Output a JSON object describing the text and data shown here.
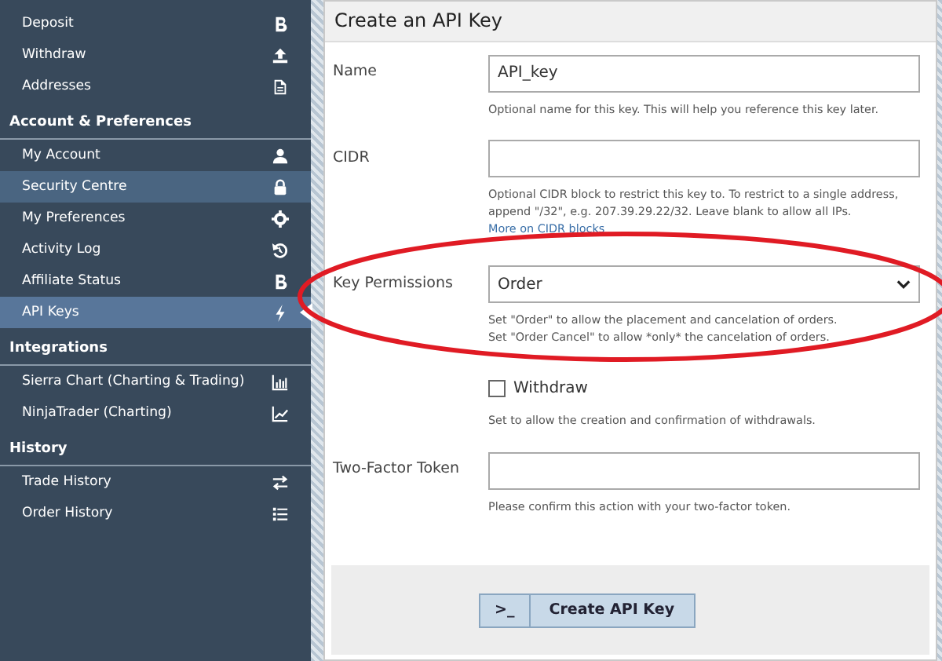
{
  "sidebar": {
    "sections": [
      {
        "items": [
          {
            "label": "Deposit",
            "selected": false,
            "highlighted": false
          },
          {
            "label": "Withdraw",
            "selected": false,
            "highlighted": false
          },
          {
            "label": "Addresses",
            "selected": false,
            "highlighted": false
          }
        ]
      },
      {
        "title": "Account & Preferences",
        "items": [
          {
            "label": "My Account",
            "selected": false,
            "highlighted": false
          },
          {
            "label": "Security Centre",
            "selected": false,
            "highlighted": true
          },
          {
            "label": "My Preferences",
            "selected": false,
            "highlighted": false
          },
          {
            "label": "Activity Log",
            "selected": false,
            "highlighted": false
          },
          {
            "label": "Affiliate Status",
            "selected": false,
            "highlighted": false
          },
          {
            "label": "API Keys",
            "selected": true,
            "highlighted": false
          }
        ]
      },
      {
        "title": "Integrations",
        "items": [
          {
            "label": "Sierra Chart (Charting & Trading)",
            "selected": false,
            "highlighted": false
          },
          {
            "label": "NinjaTrader (Charting)",
            "selected": false,
            "highlighted": false
          }
        ]
      },
      {
        "title": "History",
        "items": [
          {
            "label": "Trade History",
            "selected": false,
            "highlighted": false
          },
          {
            "label": "Order History",
            "selected": false,
            "highlighted": false
          }
        ]
      }
    ]
  },
  "panel": {
    "title": "Create an API Key",
    "fields": [
      {
        "kind": "text",
        "label": "Name",
        "value": "API_key",
        "help": "Optional name for this key. This will help you reference this key later."
      },
      {
        "kind": "text",
        "label": "CIDR",
        "help": "Optional CIDR block to restrict this key to. To restrict to a single address, append \"/32\", e.g. 207.39.29.22/32. Leave blank to allow all IPs.",
        "link": "More on CIDR blocks"
      },
      {
        "kind": "select",
        "label": "Key Permissions",
        "value": "Order",
        "help_lines": [
          "Set \"Order\" to allow the placement and cancelation of orders.",
          "Set \"Order Cancel\" to allow *only* the cancelation of orders."
        ]
      },
      {
        "kind": "checkbox",
        "label": "Withdraw",
        "checked": false,
        "help": "Set to allow the creation and confirmation of withdrawals."
      },
      {
        "kind": "text",
        "label": "Two-Factor Token",
        "help": "Please confirm this action with your two-factor token."
      }
    ],
    "submit": {
      "icon_text": ">_",
      "label": "Create API Key"
    }
  }
}
